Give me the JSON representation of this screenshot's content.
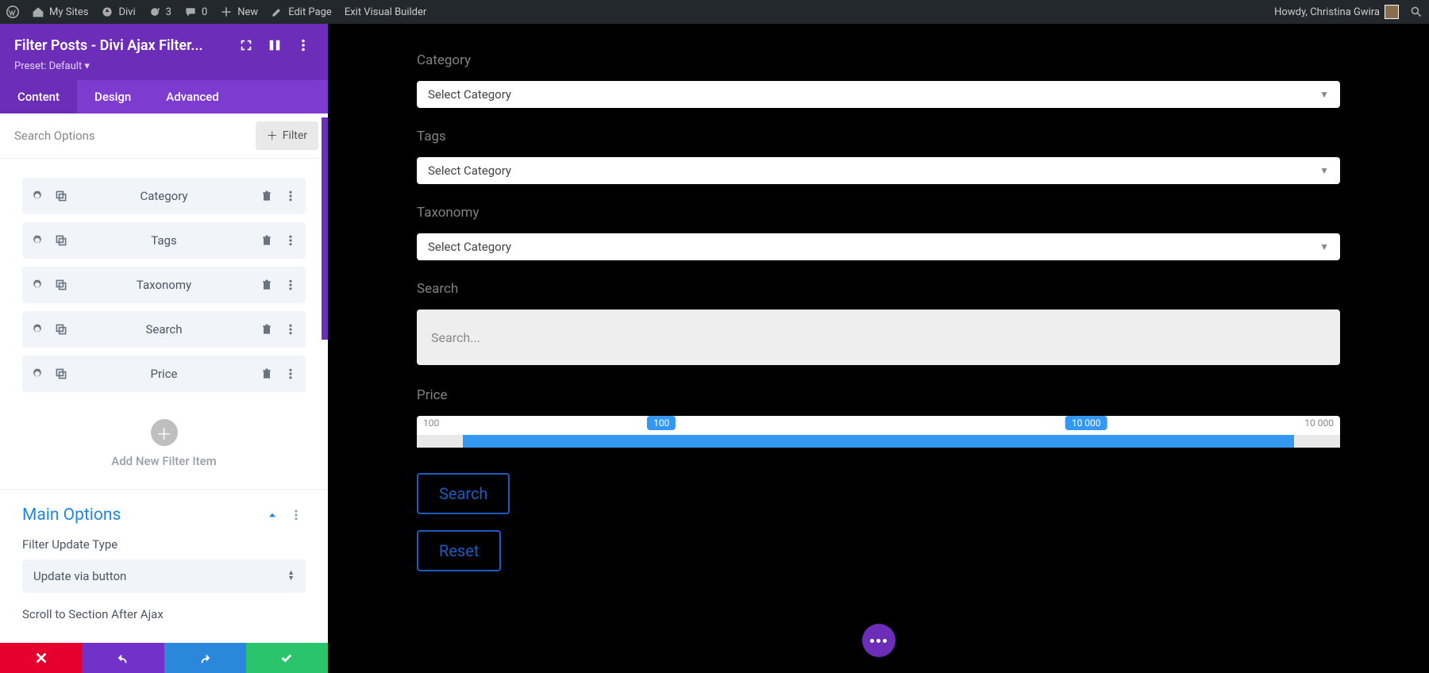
{
  "wp_bar": {
    "my_sites": "My Sites",
    "divi": "Divi",
    "refresh_count": "3",
    "comments_count": "0",
    "new": "New",
    "edit_page": "Edit Page",
    "exit_vb": "Exit Visual Builder",
    "howdy": "Howdy, Christina Gwira"
  },
  "sidebar": {
    "title": "Filter Posts - Divi Ajax Filter...",
    "preset": "Preset: Default ▾",
    "tabs": {
      "content": "Content",
      "design": "Design",
      "advanced": "Advanced"
    },
    "search_options": "Search Options",
    "add_filter": "Filter",
    "items": [
      {
        "label": "Category"
      },
      {
        "label": "Tags"
      },
      {
        "label": "Taxonomy"
      },
      {
        "label": "Search"
      },
      {
        "label": "Price"
      }
    ],
    "add_new": "Add New Filter Item",
    "main_options": "Main Options",
    "filter_update_type_label": "Filter Update Type",
    "filter_update_type_value": "Update via button",
    "scroll_cutoff": "Scroll to Section After Ajax"
  },
  "preview": {
    "category_label": "Category",
    "tags_label": "Tags",
    "taxonomy_label": "Taxonomy",
    "search_label": "Search",
    "price_label": "Price",
    "select_placeholder": "Select Category",
    "search_placeholder": "Search...",
    "price_min_outer": "100",
    "price_max_outer": "10 000",
    "price_min_badge": "100",
    "price_max_badge": "10 000",
    "search_btn": "Search",
    "reset_btn": "Reset"
  }
}
